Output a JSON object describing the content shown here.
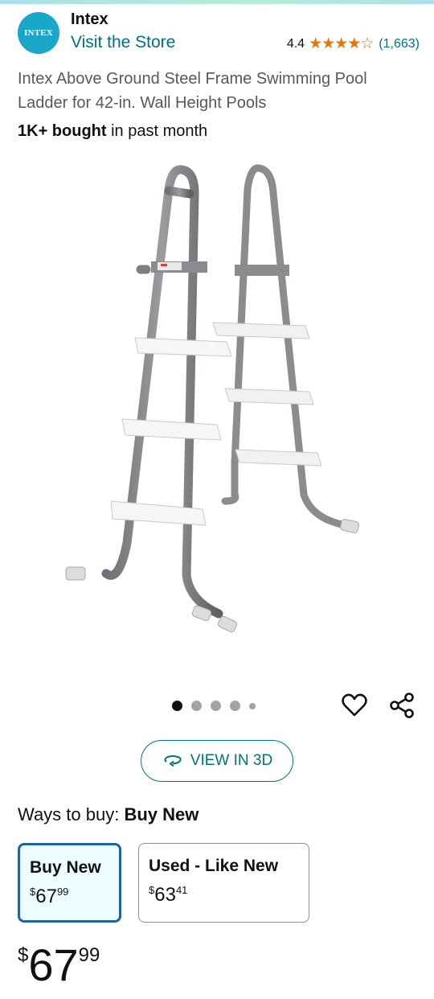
{
  "brand": {
    "logo_text": "INTEX",
    "name": "Intex",
    "visit_store": "Visit the Store"
  },
  "rating": {
    "value": "4.4",
    "stars": 4.4,
    "count": "(1,663)"
  },
  "product": {
    "title": "Intex Above Ground Steel Frame Swimming Pool Ladder for 42-in. Wall Height Pools",
    "bought_bold": "1K+ bought",
    "bought_rest": " in past month"
  },
  "gallery": {
    "image_count": 5,
    "active_index": 0,
    "view3d_label": "VIEW IN 3D"
  },
  "buy": {
    "ways_label": "Ways to buy: ",
    "ways_selected": "Buy New",
    "options": [
      {
        "label": "Buy New",
        "currency": "$",
        "whole": "67",
        "fraction": "99",
        "selected": true
      },
      {
        "label": "Used - Like New",
        "currency": "$",
        "whole": "63",
        "fraction": "41",
        "selected": false
      }
    ]
  },
  "price": {
    "currency": "$",
    "whole": "67",
    "fraction": "99"
  },
  "colors": {
    "link": "#007185",
    "star": "#e77600",
    "selected_border": "#2162a1",
    "logo": "#1aa6c8"
  }
}
